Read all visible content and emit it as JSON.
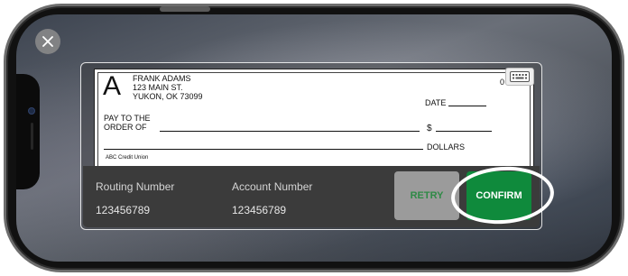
{
  "check": {
    "logo_letter": "A",
    "address_lines": [
      "FRANK ADAMS",
      "123 MAIN ST.",
      "YUKON, OK 73099"
    ],
    "check_number": "0",
    "date_label": "DATE",
    "pay_to_line1": "PAY TO THE",
    "pay_to_line2": "ORDER OF",
    "dollar_sign": "$",
    "dollars_label": "DOLLARS",
    "bank_name": "ABC Credit Union"
  },
  "info": {
    "routing_label": "Routing Number",
    "routing_value": "123456789",
    "account_label": "Account Number",
    "account_value": "123456789"
  },
  "actions": {
    "retry_label": "RETRY",
    "confirm_label": "CONFIRM"
  },
  "colors": {
    "confirm": "#0f8a3c",
    "retry_bg": "#9b9b9b",
    "retry_text": "#2f8a46",
    "panel": "#3b3b3b"
  },
  "icons": {
    "close": "close-icon",
    "keyboard": "keyboard-icon"
  }
}
